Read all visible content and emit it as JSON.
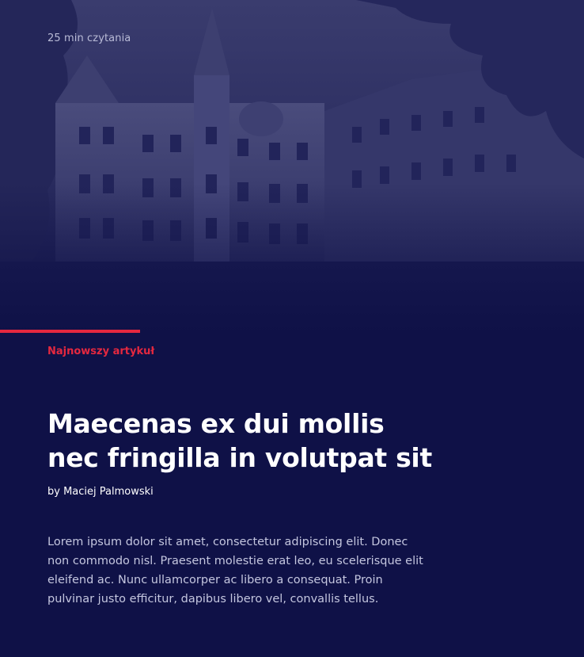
{
  "article": {
    "reading_time": "25 min czytania",
    "category": "Najnowszy artykuł",
    "title": "Maecenas ex dui mollis nec fringilla in volutpat sit",
    "author": "by Maciej Palmowski",
    "excerpt": "Lorem ipsum dolor sit amet, consectetur adipiscing elit. Donec non commodo nisl. Praesent molestie erat leo, eu scelerisque elit eleifend ac. Nunc ullamcorper ac libero a consequat. Proin pulvinar justo efficitur, dapibus libero vel, convallis tellus."
  },
  "colors": {
    "background": "#0f1147",
    "accent": "#e5283f",
    "title": "#ffffff",
    "body_text": "#c4c6df"
  }
}
